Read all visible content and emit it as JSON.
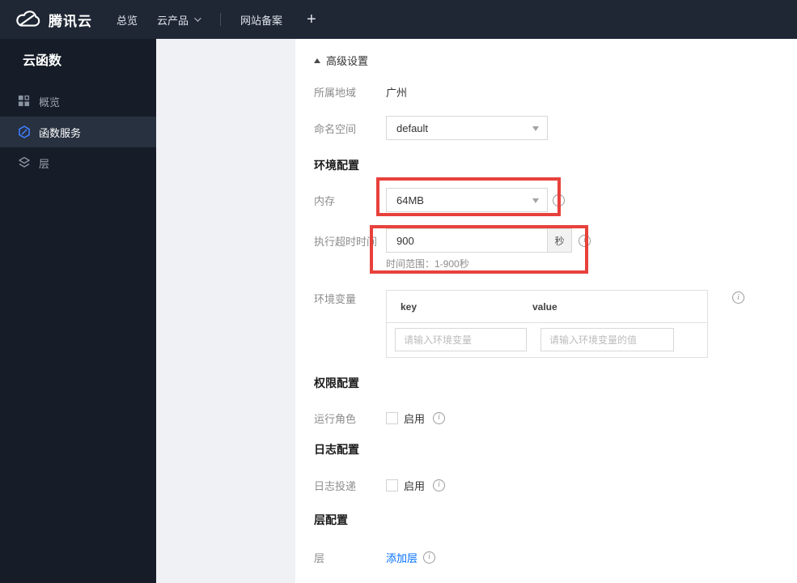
{
  "topbar": {
    "brand_label": "腾讯云",
    "nav": [
      {
        "label": "总览"
      },
      {
        "label": "云产品",
        "has_menu": true
      },
      {
        "label": "网站备案"
      }
    ],
    "add_label": "+"
  },
  "sidebar": {
    "title": "云函数",
    "items": [
      {
        "label": "概览",
        "icon": "grid-icon",
        "active": false
      },
      {
        "label": "函数服务",
        "icon": "function-hexagon-icon",
        "active": true
      },
      {
        "label": "层",
        "icon": "layers-icon",
        "active": false
      }
    ]
  },
  "main": {
    "advanced_settings_label": "高级设置",
    "region": {
      "label": "所属地域",
      "value": "广州"
    },
    "namespace": {
      "label": "命名空间",
      "value": "default"
    },
    "env_config": {
      "title": "环境配置",
      "memory": {
        "label": "内存",
        "value": "64MB"
      },
      "timeout": {
        "label": "执行超时时间",
        "value": "900",
        "unit": "秒",
        "hint": "时间范围：1-900秒"
      },
      "env_vars": {
        "label": "环境变量",
        "key_header": "key",
        "value_header": "value",
        "key_placeholder": "请输入环境变量",
        "value_placeholder": "请输入环境变量的值"
      }
    },
    "permission_config": {
      "title": "权限配置",
      "role_label": "运行角色",
      "enable_label": "启用",
      "enabled": false
    },
    "log_config": {
      "title": "日志配置",
      "delivery_label": "日志投递",
      "enable_label": "启用",
      "enabled": false
    },
    "layer_config": {
      "title": "层配置",
      "layer_label": "层",
      "add_layer_label": "添加层"
    }
  },
  "icons": {
    "info_glyph": "i"
  },
  "colors": {
    "topbar_bg": "#1f2735",
    "sidebar_bg": "#161d28",
    "active_item_bg": "#28313f",
    "function_icon_blue": "#3e7bfa",
    "link_blue": "#006eff",
    "highlight_red": "#e8413c"
  }
}
